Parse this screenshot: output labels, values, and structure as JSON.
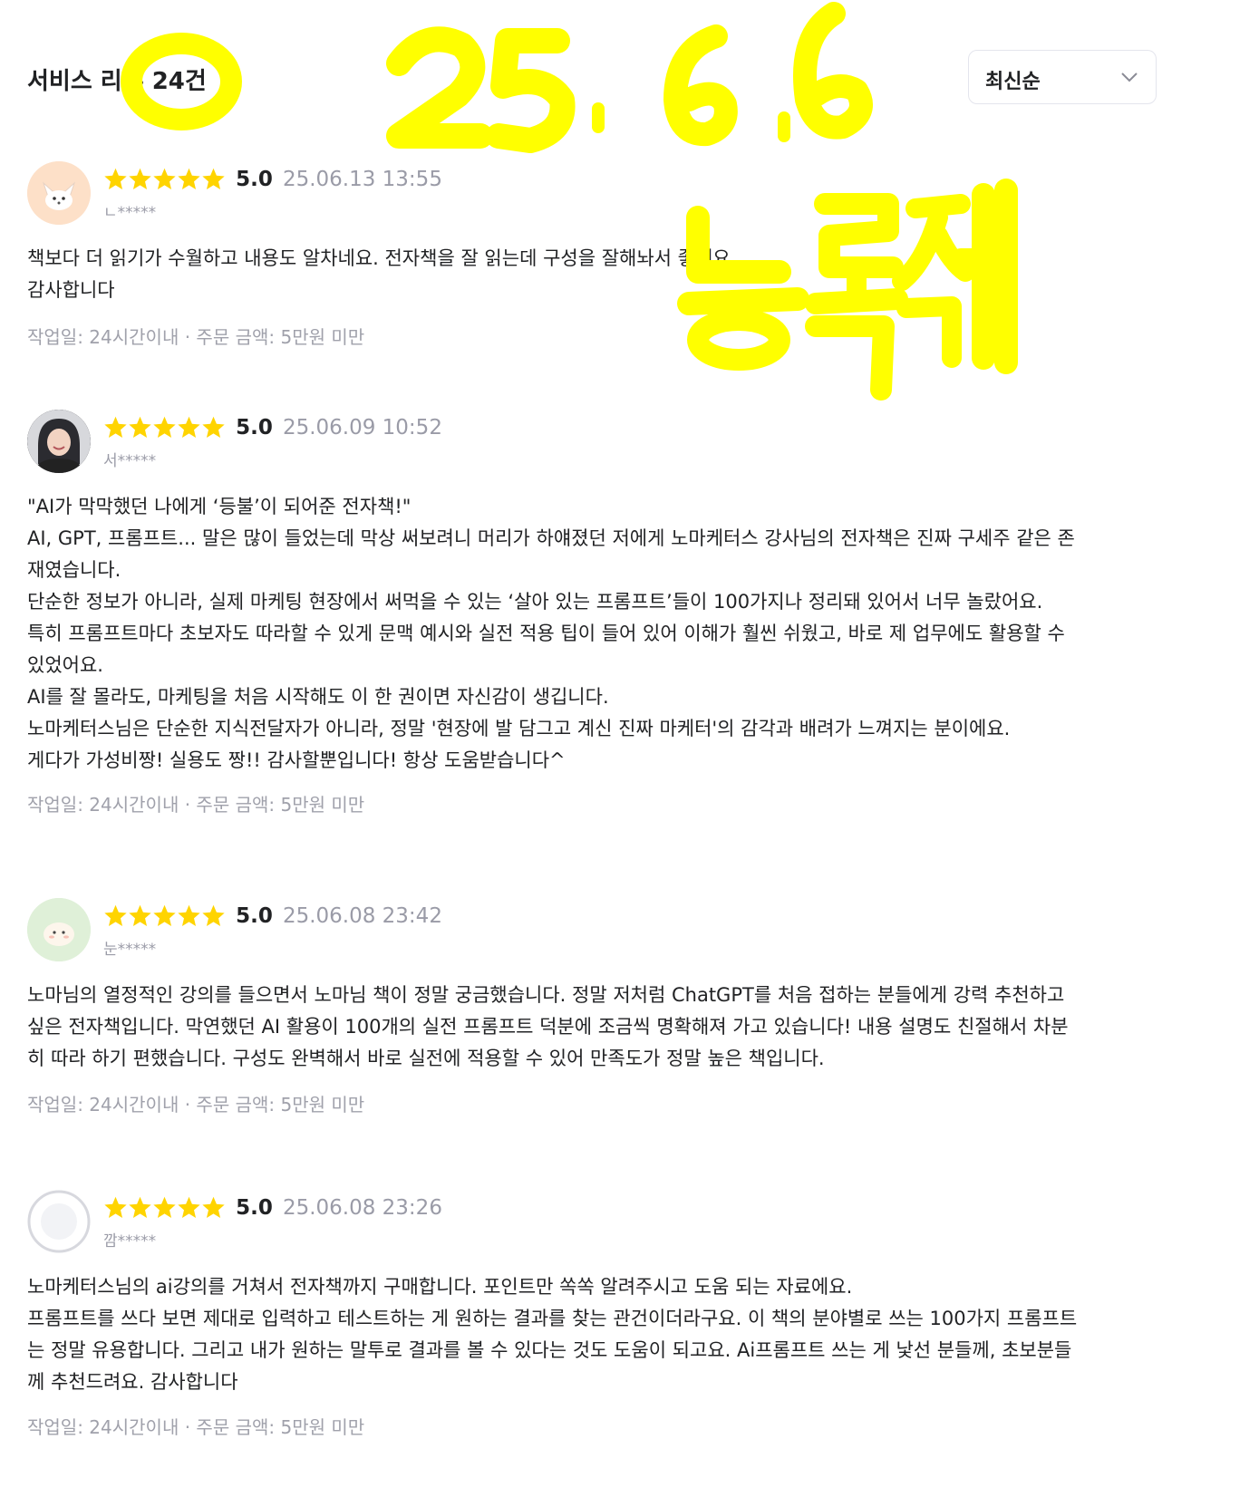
{
  "header": {
    "title": "서비스 리뷰 24건",
    "sort": {
      "selected": "최신순",
      "icon": "chevron-down-icon"
    }
  },
  "colors": {
    "star": "#ffd400",
    "annotation": "#ffff00",
    "muted": "#9a9ba7"
  },
  "reviews": [
    {
      "rating": 5,
      "score": "5.0",
      "date": "25.06.13 13:55",
      "user": "ㄴ*****",
      "avatar": "fox-avatar",
      "lines": [
        "책보다 더 읽기가 수월하고 내용도 알차네요. 전자책을 잘 읽는데 구성을 잘해놔서 좋네요",
        "감사합니다"
      ],
      "meta": "작업일: 24시간이내 · 주문 금액: 5만원 미만"
    },
    {
      "rating": 5,
      "score": "5.0",
      "date": "25.06.09 10:52",
      "user": "서*****",
      "avatar": "person-photo-avatar",
      "lines": [
        "\"AI가 막막했던 나에게 ‘등불’이 되어준 전자책!\"",
        "AI, GPT, 프롬프트... 말은 많이 들었는데 막상 써보려니 머리가 하얘졌던 저에게 노마케터스 강사님의 전자책은 진짜 구세주 같은 존",
        "재였습니다.",
        "단순한 정보가 아니라, 실제 마케팅 현장에서 써먹을 수 있는 ‘살아 있는 프롬프트’들이 100가지나 정리돼 있어서 너무 놀랐어요.",
        "특히 프롬프트마다 초보자도 따라할 수 있게 문맥 예시와 실전 적용 팁이 들어 있어 이해가 훨씬 쉬웠고, 바로 제 업무에도 활용할 수",
        "있었어요.",
        "AI를 잘 몰라도, 마케팅을 처음 시작해도 이 한 권이면 자신감이 생깁니다.",
        "노마케터스님은 단순한 지식전달자가 아니라, 정말 '현장에 발 담그고 계신 진짜 마케터'의 감각과 배려가 느껴지는 분이에요.",
        "게다가 가성비짱!  실용도 짱!!  감사할뿐입니다!  항상 도움받습니다^"
      ],
      "meta": "작업일: 24시간이내 · 주문 금액: 5만원 미만"
    },
    {
      "rating": 5,
      "score": "5.0",
      "date": "25.06.08 23:42",
      "user": "눈*****",
      "avatar": "mochi-avatar",
      "lines": [
        "노마님의 열정적인 강의를 들으면서 노마님 책이 정말 궁금했습니다. 정말 저처럼 ChatGPT를 처음 접하는 분들에게 강력 추천하고",
        "싶은 전자책입니다. 막연했던 AI 활용이 100개의 실전 프롬프트 덕분에 조금씩 명확해져 가고 있습니다! 내용 설명도 친절해서 차분",
        "히 따라 하기 편했습니다. 구성도 완벽해서 바로 실전에 적용할 수 있어 만족도가 정말 높은 책입니다."
      ],
      "meta": "작업일: 24시간이내 · 주문 금액: 5만원 미만"
    },
    {
      "rating": 5,
      "score": "5.0",
      "date": "25.06.08 23:26",
      "user": "깜*****",
      "avatar": "default-avatar",
      "lines": [
        "노마케터스님의 ai강의를 거쳐서 전자책까지 구매합니다. 포인트만 쏙쏙 알려주시고 도움 되는 자료에요.",
        "프롬프트를 쓰다 보면 제대로 입력하고 테스트하는 게 원하는 결과를 찾는 관건이더라구요. 이 책의 분야별로 쓰는 100가지 프롬프트",
        "는 정말 유용합니다. 그리고 내가 원하는 말투로 결과를 볼 수 있다는 것도 도움이 되고요. Ai프롬프트 쓰는 게 낯선 분들께, 초보분들",
        "께 추천드려요. 감사합니다"
      ],
      "meta": "작업일: 24시간이내 · 주문 금액: 5만원 미만"
    }
  ],
  "annotation": {
    "text": "Q 25.6.6 등록책"
  }
}
